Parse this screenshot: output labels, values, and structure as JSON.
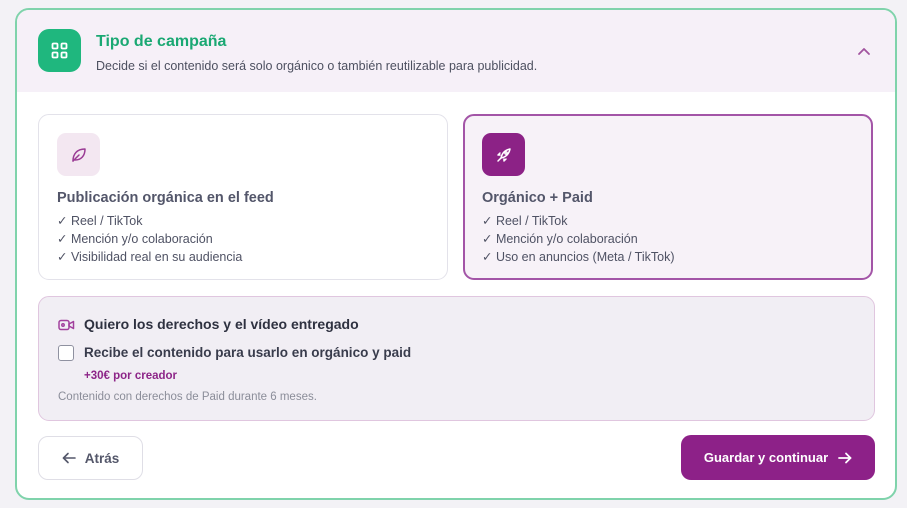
{
  "header": {
    "title": "Tipo de campaña",
    "subtitle": "Decide si el contenido será solo orgánico o también reutilizable para publicidad.",
    "icon": "grid-icon",
    "collapse_icon": "chevron-up-icon"
  },
  "options": [
    {
      "title": "Publicación orgánica en el feed",
      "icon": "leaf-icon",
      "selected": false,
      "items": [
        "✓ Reel / TikTok",
        "✓ Mención y/o colaboración",
        "✓ Visibilidad real en su audiencia"
      ]
    },
    {
      "title": "Orgánico + Paid",
      "icon": "rocket-icon",
      "selected": true,
      "items": [
        "✓ Reel / TikTok",
        "✓ Mención y/o colaboración",
        "✓ Uso en anuncios (Meta / TikTok)"
      ]
    }
  ],
  "rights": {
    "icon": "video-camera-icon",
    "title": "Quiero los derechos y el vídeo entregado",
    "checkbox_label": "Recibe el contenido para usarlo en orgánico y paid",
    "checked": false,
    "price": "+30€ por creador",
    "note": "Contenido con derechos de Paid durante 6 meses."
  },
  "footer": {
    "back_label": "Atrás",
    "save_label": "Guardar y continuar"
  },
  "colors": {
    "accent_green": "#1fb77e",
    "accent_purple": "#8d2188",
    "selected_border": "#a355a7",
    "panel_border": "#7fd3ab"
  }
}
